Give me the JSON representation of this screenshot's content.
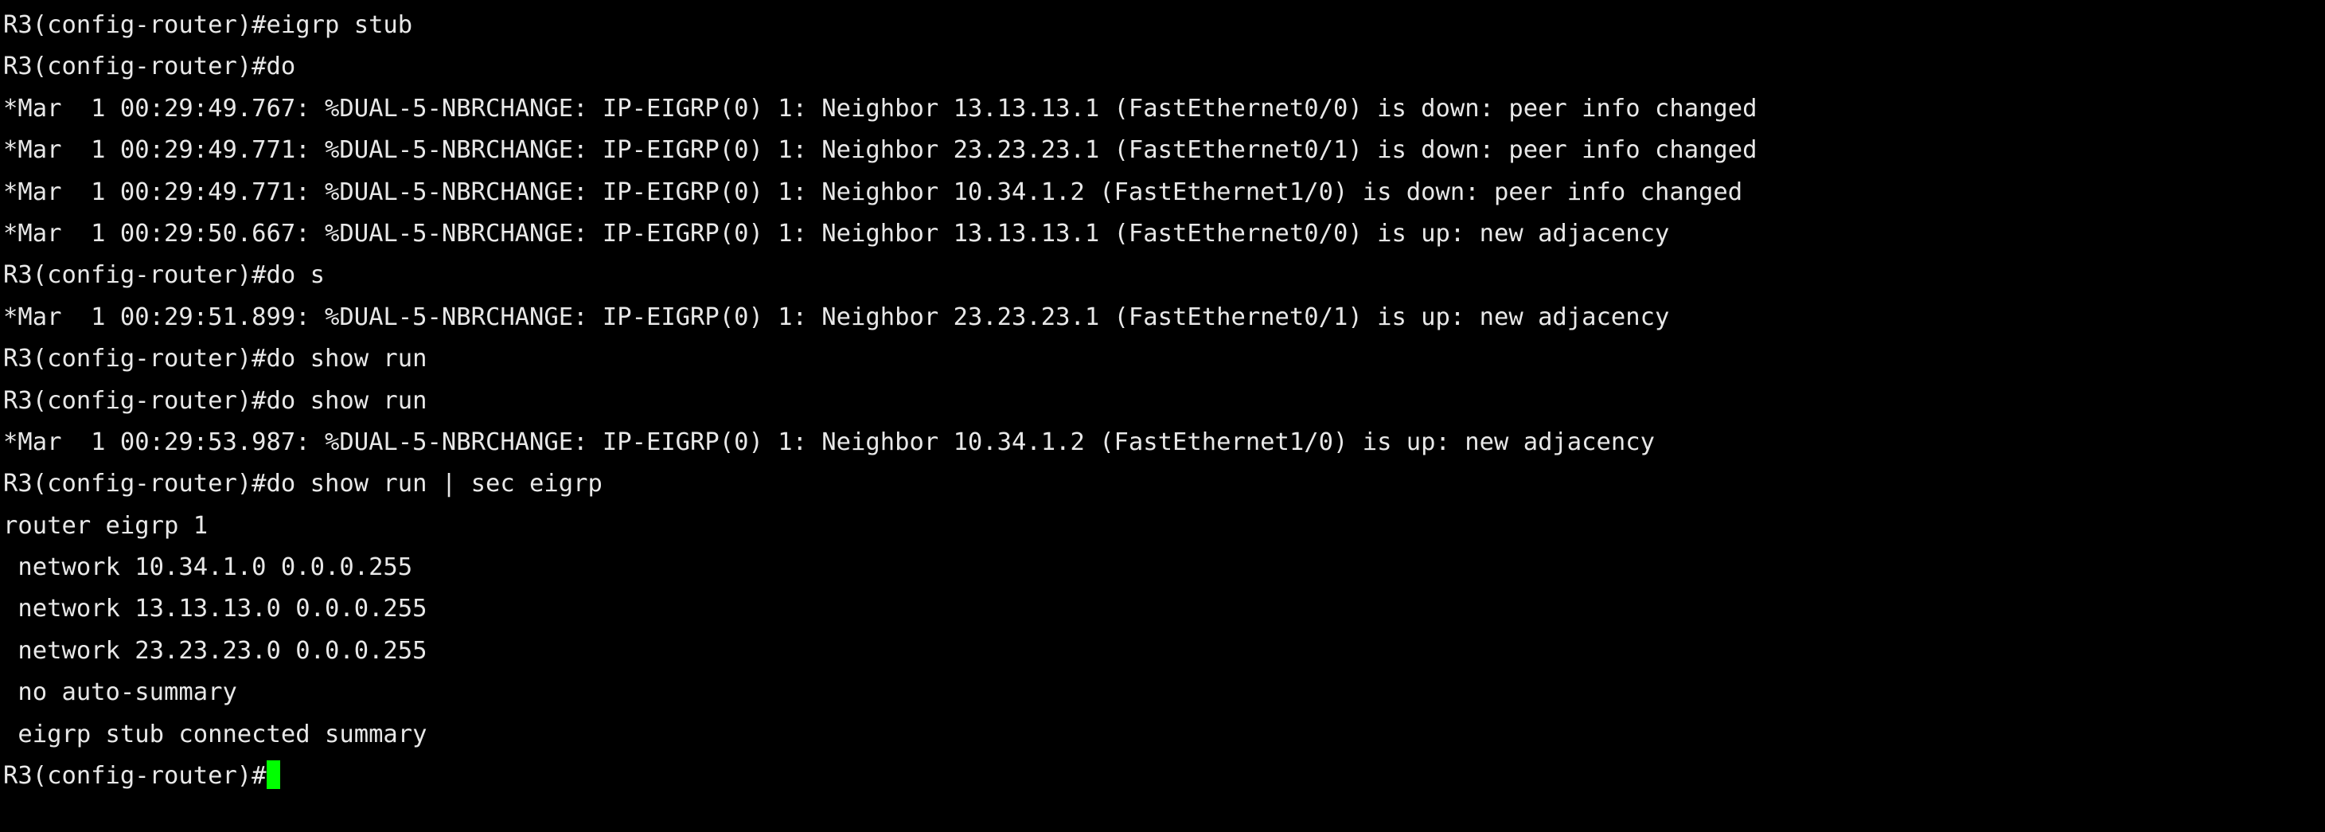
{
  "terminal": {
    "title": "R3 Cisco IOS CLI",
    "background_color": "#000000",
    "foreground_color": "#e8e8e8",
    "cursor_color": "#00ff00",
    "prompt": "R3(config-router)#",
    "hostname": "R3",
    "mode": "config-router",
    "lines": [
      "R3(config-router)#eigrp stub",
      "R3(config-router)#do",
      "*Mar  1 00:29:49.767: %DUAL-5-NBRCHANGE: IP-EIGRP(0) 1: Neighbor 13.13.13.1 (FastEthernet0/0) is down: peer info changed",
      "*Mar  1 00:29:49.771: %DUAL-5-NBRCHANGE: IP-EIGRP(0) 1: Neighbor 23.23.23.1 (FastEthernet0/1) is down: peer info changed",
      "*Mar  1 00:29:49.771: %DUAL-5-NBRCHANGE: IP-EIGRP(0) 1: Neighbor 10.34.1.2 (FastEthernet1/0) is down: peer info changed",
      "*Mar  1 00:29:50.667: %DUAL-5-NBRCHANGE: IP-EIGRP(0) 1: Neighbor 13.13.13.1 (FastEthernet0/0) is up: new adjacency",
      "R3(config-router)#do s",
      "*Mar  1 00:29:51.899: %DUAL-5-NBRCHANGE: IP-EIGRP(0) 1: Neighbor 23.23.23.1 (FastEthernet0/1) is up: new adjacency",
      "R3(config-router)#do show run",
      "R3(config-router)#do show run",
      "*Mar  1 00:29:53.987: %DUAL-5-NBRCHANGE: IP-EIGRP(0) 1: Neighbor 10.34.1.2 (FastEthernet1/0) is up: new adjacency",
      "R3(config-router)#do show run | sec eigrp",
      "router eigrp 1",
      " network 10.34.1.0 0.0.0.255",
      " network 13.13.13.0 0.0.0.255",
      " network 23.23.23.0 0.0.0.255",
      " no auto-summary",
      " eigrp stub connected summary"
    ],
    "last_prompt_line": "R3(config-router)#"
  }
}
